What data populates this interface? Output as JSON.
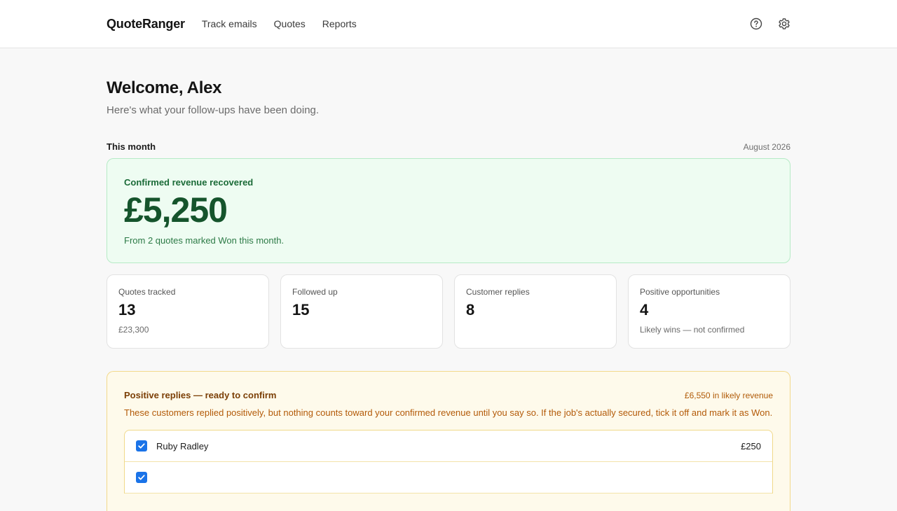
{
  "header": {
    "brand": "QuoteRanger",
    "nav": [
      "Track emails",
      "Quotes",
      "Reports"
    ],
    "icons": [
      "help-icon",
      "gear-icon"
    ]
  },
  "welcome": {
    "title": "Welcome, Alex",
    "subtitle": "Here's what your follow-ups have been doing."
  },
  "month": {
    "label": "This month",
    "date": "August 2026"
  },
  "revenue": {
    "label": "Confirmed revenue recovered",
    "value": "£5,250",
    "note": "From 2 quotes marked Won this month."
  },
  "stats": [
    {
      "label": "Quotes tracked",
      "value": "13",
      "sub": "£23,300"
    },
    {
      "label": "Followed up",
      "value": "15",
      "sub": ""
    },
    {
      "label": "Customer replies",
      "value": "8",
      "sub": ""
    },
    {
      "label": "Positive opportunities",
      "value": "4",
      "sub": "Likely wins — not confirmed"
    }
  ],
  "positive": {
    "title": "Positive replies — ready to confirm",
    "likely": "£6,550 in likely revenue",
    "description": "These customers replied positively, but nothing counts toward your confirmed revenue until you say so. If the job's actually secured, tick it off and mark it as Won.",
    "rows": [
      {
        "name": "Ruby Radley",
        "amount": "£250",
        "checked": true
      },
      {
        "name": "",
        "amount": "",
        "checked": true
      }
    ]
  },
  "colors": {
    "accent_green": "#15542c",
    "revenue_bg": "#eefcf2",
    "positive_bg": "#fefaeb",
    "checkbox": "#1a73e8"
  }
}
